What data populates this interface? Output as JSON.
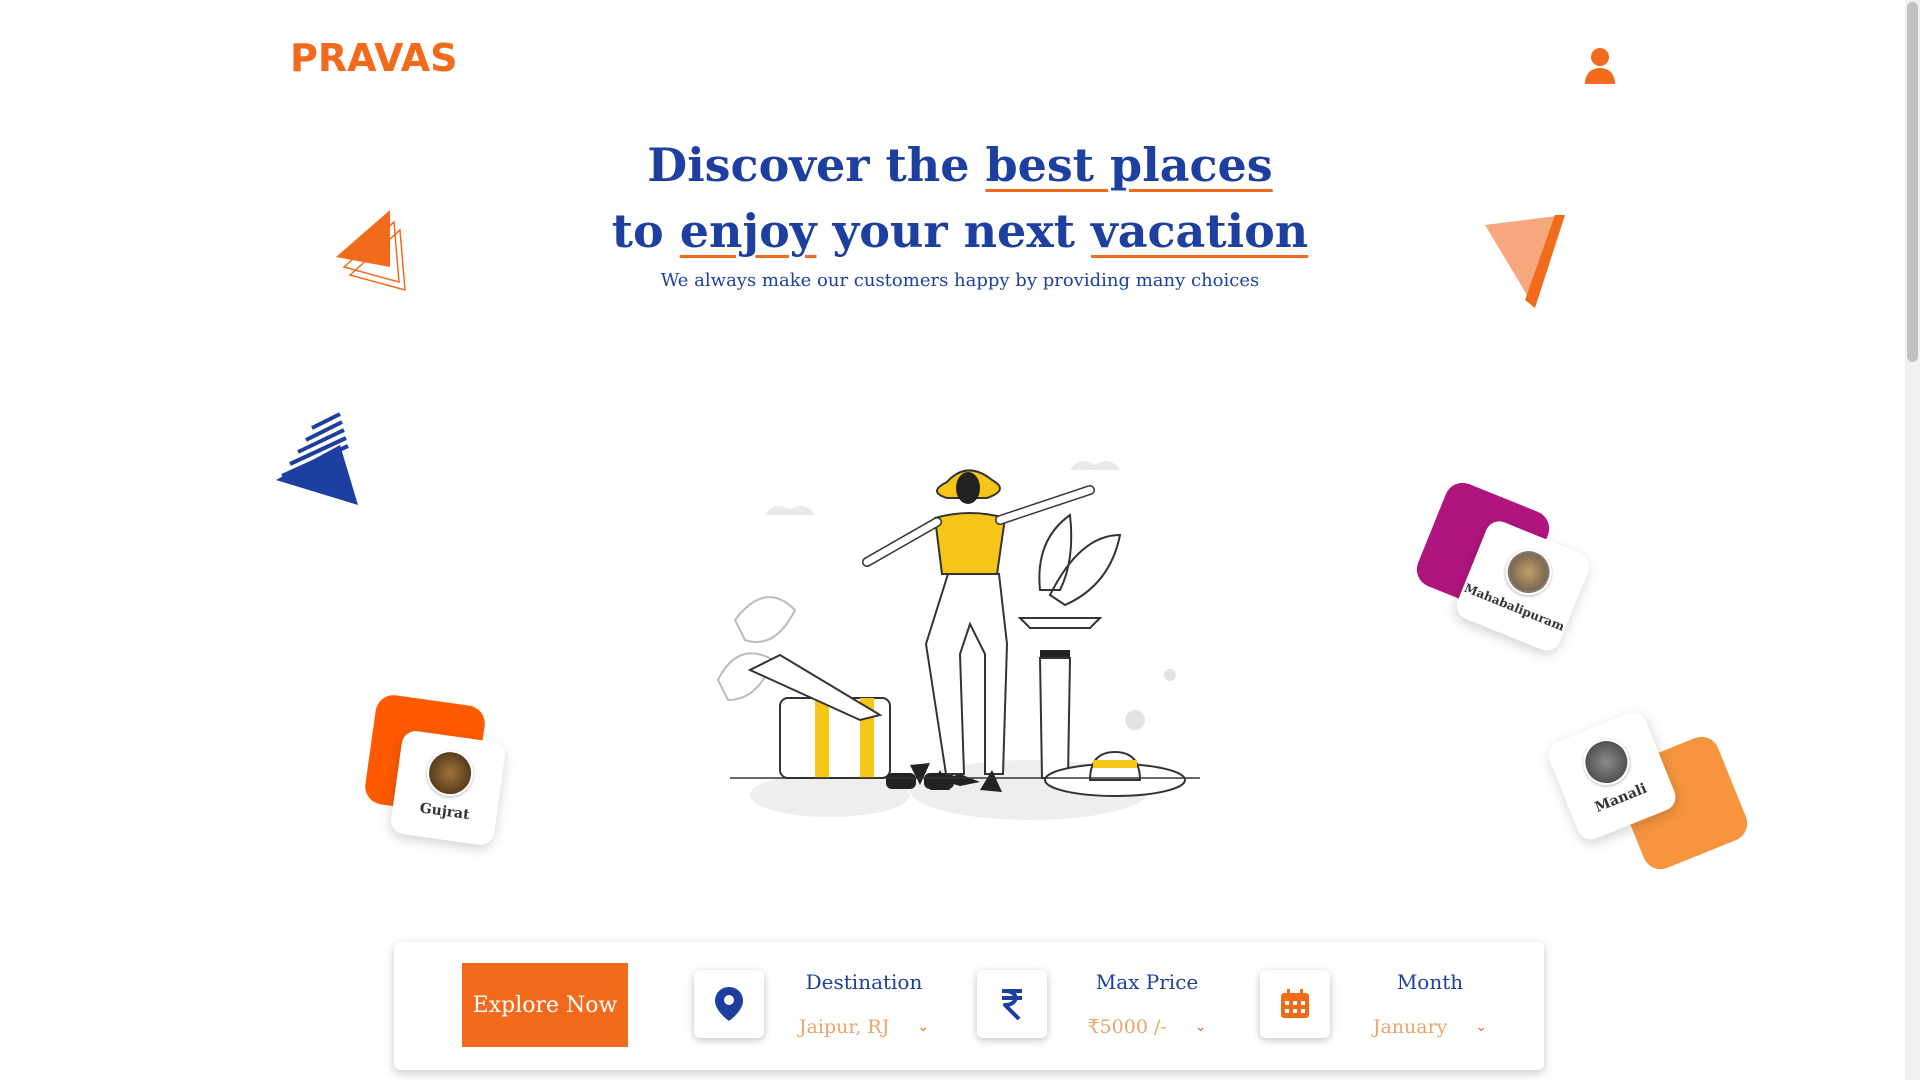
{
  "brand": {
    "name": "PRAVAS",
    "color": "#f26b1d"
  },
  "header": {
    "user_icon": "user-icon"
  },
  "hero": {
    "line1_a": "Discover the ",
    "line1_b": "best places",
    "line2_a": "to ",
    "line2_b": "enjoy",
    "line2_c": " your next ",
    "line2_d": "vacation",
    "subtitle": "We always make our customers happy by providing many choices"
  },
  "destinations": [
    {
      "name": "Gujrat",
      "accent": "#ff5a00"
    },
    {
      "name": "Mahabalipuram",
      "accent": "#b0157f"
    },
    {
      "name": "Manali",
      "accent": "#f7953f"
    }
  ],
  "search": {
    "explore_label": "Explore Now",
    "destination": {
      "label": "Destination",
      "value": "Jaipur, RJ",
      "icon": "location-pin-icon"
    },
    "price": {
      "label": "Max Price",
      "value": "₹5000 /-",
      "icon": "rupee-icon"
    },
    "month": {
      "label": "Month",
      "value": "January",
      "icon": "calendar-icon"
    }
  },
  "colors": {
    "primary": "#1d3f9f",
    "accent": "#f26b1d"
  }
}
